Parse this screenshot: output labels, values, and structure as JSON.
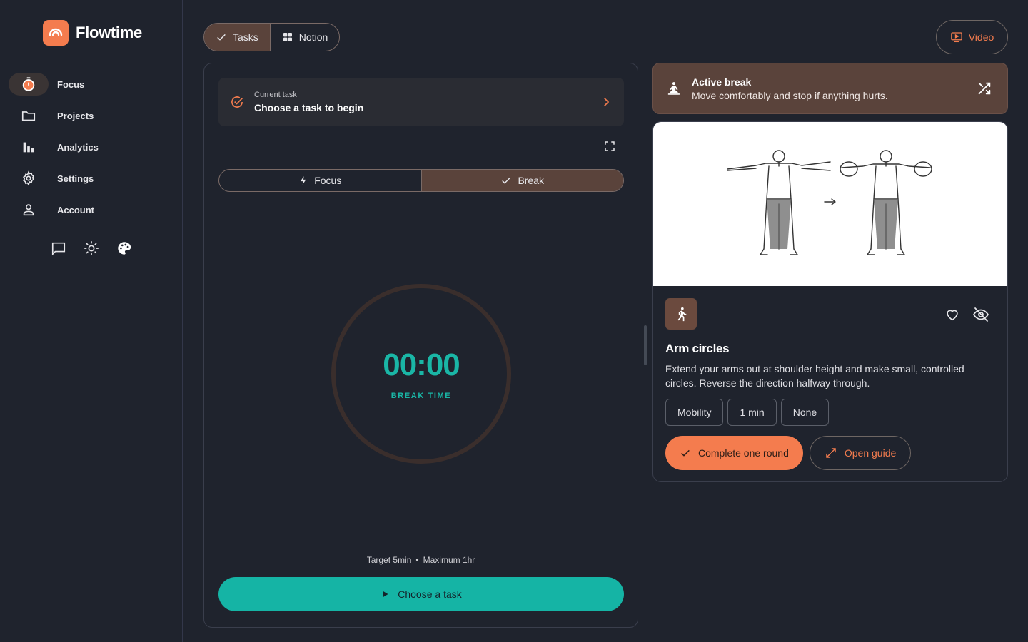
{
  "brand": {
    "name": "Flowtime"
  },
  "colors": {
    "accent": "#f47c4e",
    "teal": "#15b4a5",
    "brown": "#5a433b",
    "background": "#1f232d"
  },
  "sidebar": {
    "items": [
      {
        "label": "Focus",
        "icon": "stopwatch-icon",
        "active": true
      },
      {
        "label": "Projects",
        "icon": "folder-icon"
      },
      {
        "label": "Analytics",
        "icon": "bar-chart-icon"
      },
      {
        "label": "Settings",
        "icon": "gear-icon"
      },
      {
        "label": "Account",
        "icon": "person-icon"
      }
    ],
    "tools": [
      "feedback-icon",
      "sun-icon",
      "palette-icon"
    ]
  },
  "topbar": {
    "source_tabs": [
      {
        "label": "Tasks",
        "icon": "check-icon",
        "active": true
      },
      {
        "label": "Notion",
        "icon": "grid-icon",
        "active": false
      }
    ],
    "video_label": "Video"
  },
  "timer": {
    "task_caption": "Current task",
    "task_title": "Choose a task to begin",
    "modes": [
      {
        "label": "Focus",
        "icon": "bolt-icon",
        "active": false
      },
      {
        "label": "Break",
        "icon": "check-icon",
        "active": true
      }
    ],
    "time": "00:00",
    "label": "BREAK TIME",
    "target": "Target 5min",
    "separator": "•",
    "maximum": "Maximum 1hr",
    "cta_label": "Choose a task"
  },
  "break_banner": {
    "title": "Active break",
    "subtitle": "Move comfortably and stop if anything hurts."
  },
  "exercise": {
    "title": "Arm circles",
    "description": "Extend your arms out at shoulder height and make small, controlled circles. Reverse the direction halfway through.",
    "tags": [
      "Mobility",
      "1 min",
      "None"
    ],
    "primary_label": "Complete one round",
    "secondary_label": "Open guide"
  }
}
